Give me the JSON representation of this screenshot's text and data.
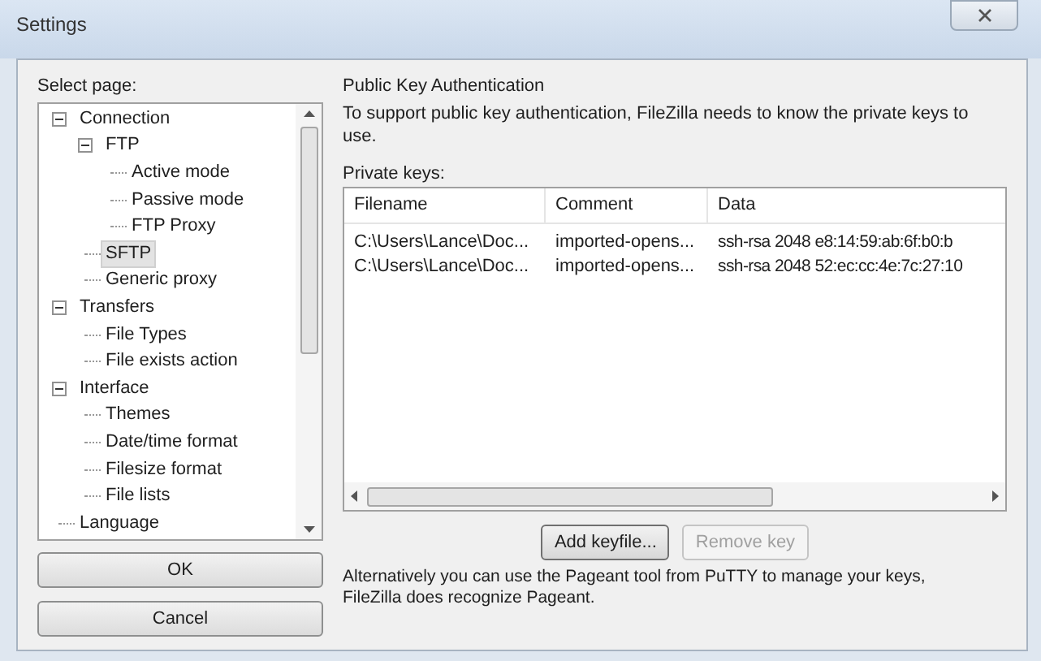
{
  "window": {
    "title": "Settings"
  },
  "select_page_label": "Select page:",
  "tree": [
    {
      "label": "Connection",
      "expanded": true,
      "selected": false,
      "children": [
        {
          "label": "FTP",
          "expanded": true,
          "selected": false,
          "children": [
            {
              "label": "Active mode",
              "selected": false
            },
            {
              "label": "Passive mode",
              "selected": false
            },
            {
              "label": "FTP Proxy",
              "selected": false
            }
          ]
        },
        {
          "label": "SFTP",
          "selected": true
        },
        {
          "label": "Generic proxy",
          "selected": false
        }
      ]
    },
    {
      "label": "Transfers",
      "expanded": true,
      "selected": false,
      "children": [
        {
          "label": "File Types",
          "selected": false
        },
        {
          "label": "File exists action",
          "selected": false
        }
      ]
    },
    {
      "label": "Interface",
      "expanded": true,
      "selected": false,
      "children": [
        {
          "label": "Themes",
          "selected": false
        },
        {
          "label": "Date/time format",
          "selected": false
        },
        {
          "label": "Filesize format",
          "selected": false
        },
        {
          "label": "File lists",
          "selected": false
        }
      ]
    },
    {
      "label": "Language",
      "selected": false
    }
  ],
  "buttons": [
    {
      "label": "OK"
    },
    {
      "label": "Cancel"
    }
  ],
  "panel": {
    "title": "Public Key Authentication",
    "description": "To support public key authentication, FileZilla needs to know the private keys to use.",
    "list_label": "Private keys:",
    "columns": [
      "Filename",
      "Comment",
      "Data"
    ],
    "rows": [
      [
        "C:\\Users\\Lance\\Doc...",
        "imported-opens...",
        "ssh-rsa 2048 e8:14:59:ab:6f:b0:b"
      ],
      [
        "C:\\Users\\Lance\\Doc...",
        "imported-opens...",
        "ssh-rsa 2048 52:ec:cc:4e:7c:27:10"
      ]
    ],
    "actions": [
      {
        "label": "Add keyfile...",
        "disabled": false
      },
      {
        "label": "Remove key",
        "disabled": true
      }
    ],
    "note": "Alternatively you can use the Pageant tool from PuTTY to manage your keys, FileZilla does recognize Pageant."
  }
}
